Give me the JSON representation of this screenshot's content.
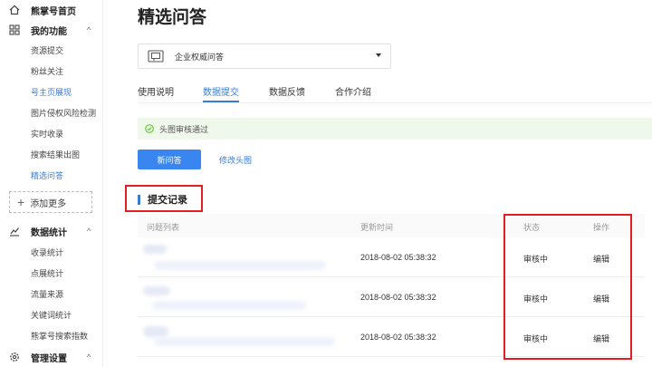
{
  "sidebar": {
    "groups": [
      {
        "label": "熊掌号首页",
        "icon": "home-icon"
      },
      {
        "label": "我的功能",
        "icon": "grid-icon"
      },
      {
        "label": "数据统计",
        "icon": "chart-icon"
      },
      {
        "label": "管理设置",
        "icon": "gear-icon"
      }
    ],
    "features": [
      "资源提交",
      "粉丝关注",
      "号主页展现",
      "图片侵权风险检测",
      "实时收录",
      "搜索结果出图",
      "精选问答"
    ],
    "stats": [
      "收录统计",
      "点展统计",
      "流量来源",
      "关键词统计",
      "熊掌号搜索指数"
    ],
    "add_more": "添加更多",
    "chevron": "^"
  },
  "main": {
    "title": "精选问答",
    "dropdown": {
      "value": "企业权威问答"
    },
    "tabs": [
      "使用说明",
      "数据提交",
      "数据反馈",
      "合作介绍"
    ],
    "notice": "头图审核通过",
    "new_button": "新问答",
    "edit_link": "修改头图",
    "section_title": "提交记录",
    "table": {
      "headers": [
        "问题列表",
        "更新时间",
        "状态",
        "操作"
      ],
      "rows": [
        {
          "time": "2018-08-02 05:38:32",
          "status": "审核中",
          "action": "编辑"
        },
        {
          "time": "2018-08-02 05:38:32",
          "status": "审核中",
          "action": "编辑"
        },
        {
          "time": "2018-08-02 05:38:32",
          "status": "审核中",
          "action": "编辑"
        }
      ]
    }
  },
  "colors": {
    "accent": "#3a7bd5",
    "button": "#3a86f0",
    "annotation": "#e02020",
    "notice_bg": "#eff8ea"
  }
}
